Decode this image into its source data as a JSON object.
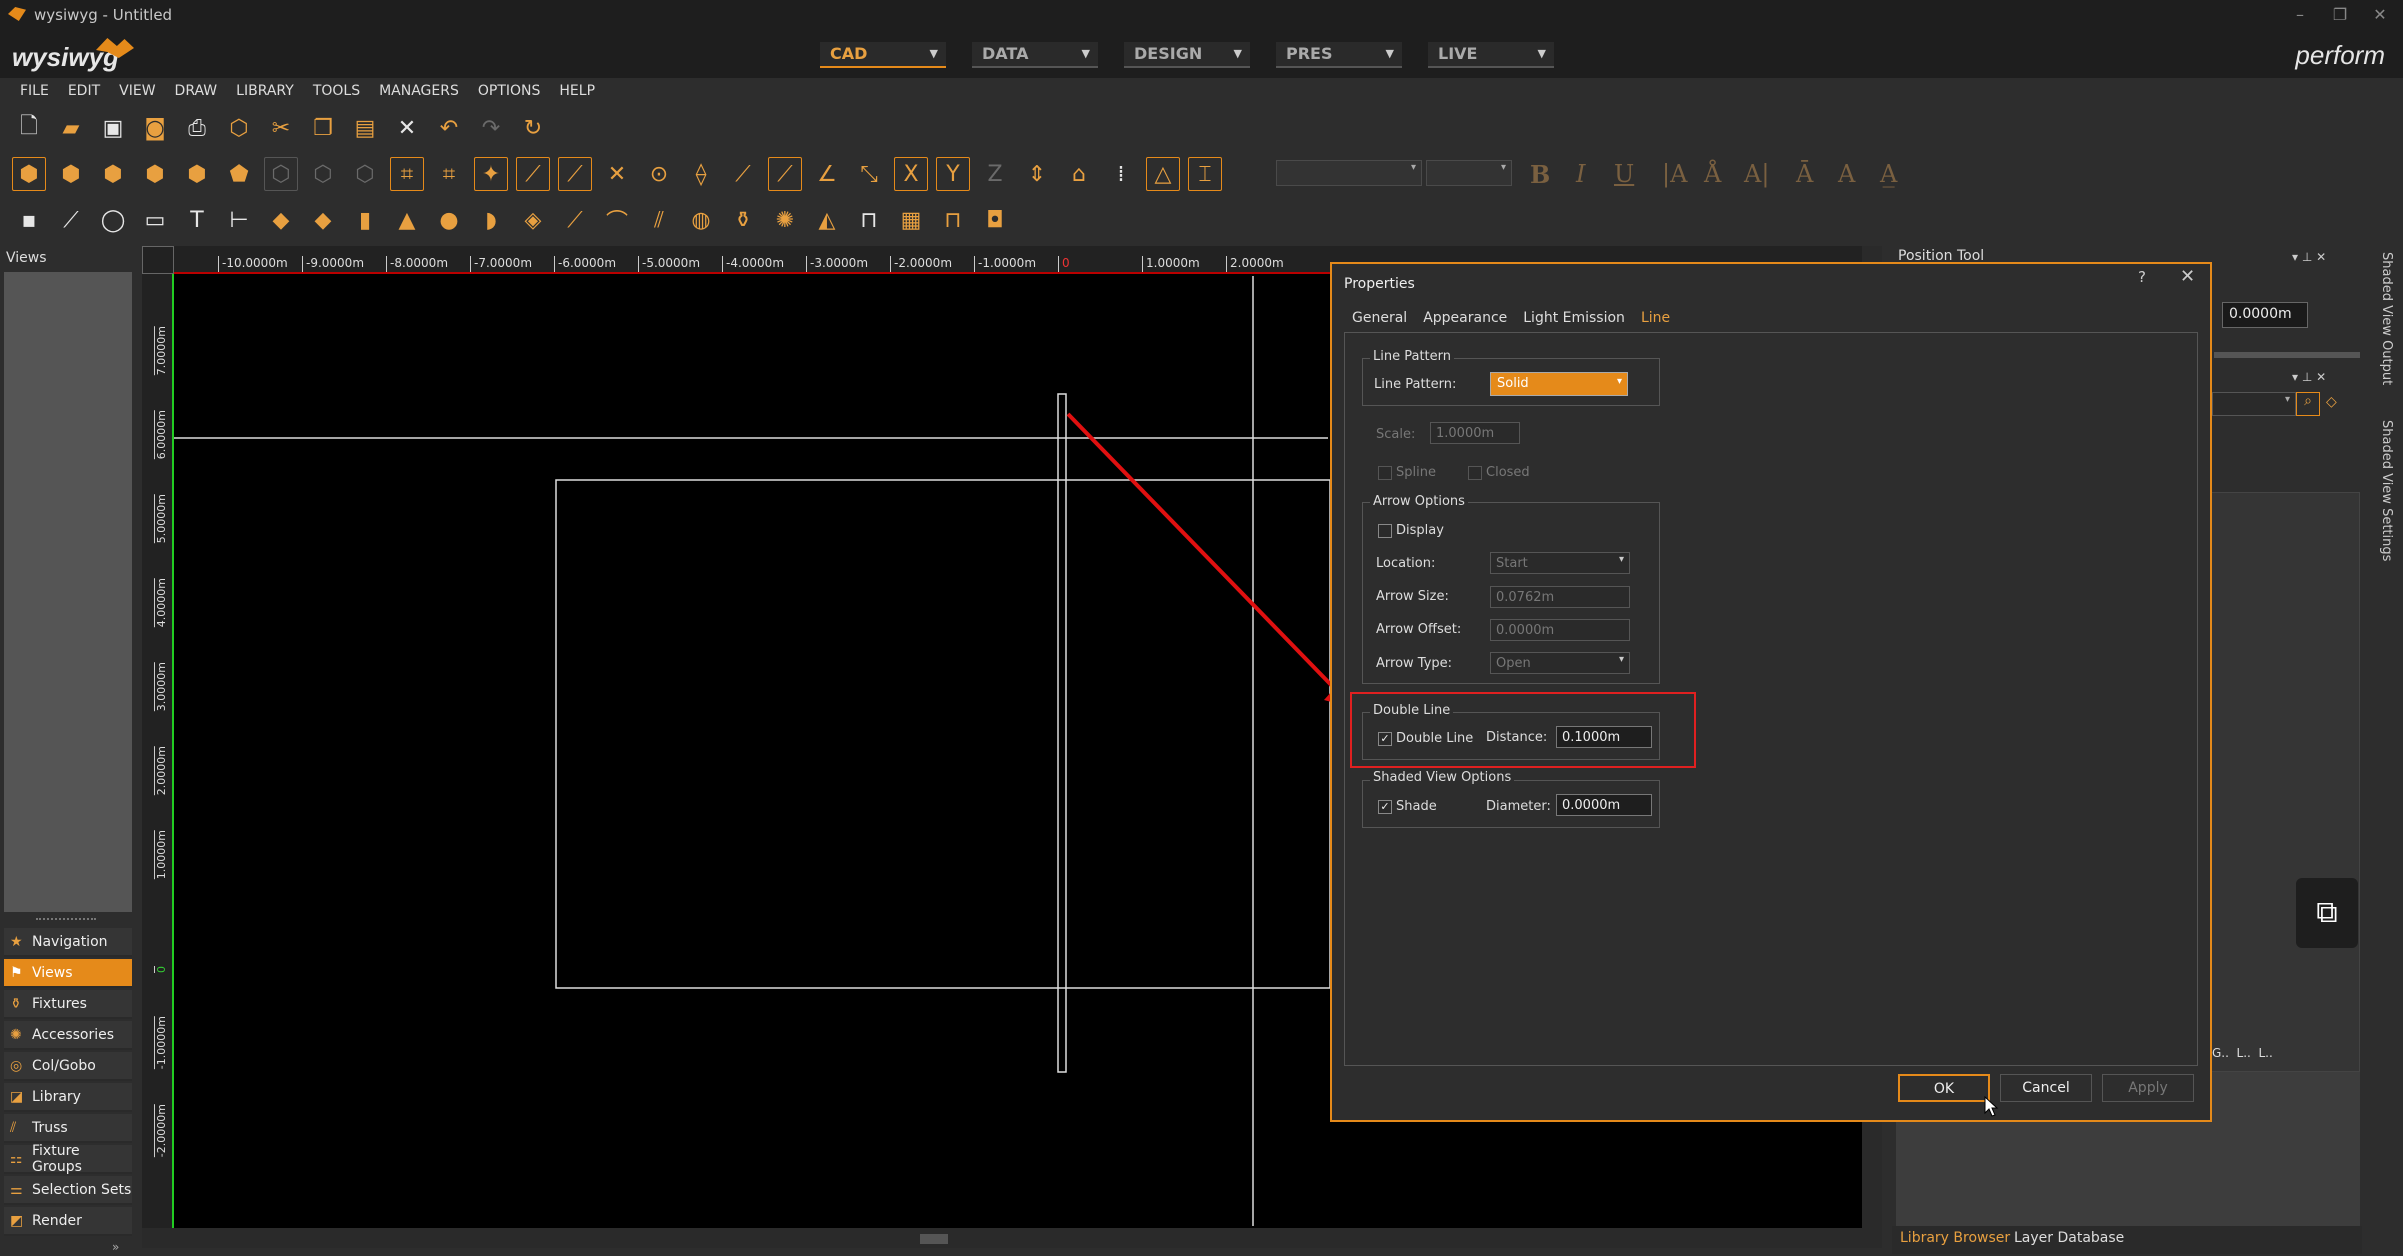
{
  "window": {
    "title": "wysiwyg - Untitled"
  },
  "header": {
    "brand": "wysiwyg",
    "product": "perform",
    "modes": [
      {
        "label": "CAD",
        "active": true
      },
      {
        "label": "DATA",
        "active": false
      },
      {
        "label": "DESIGN",
        "active": false
      },
      {
        "label": "PRES",
        "active": false
      },
      {
        "label": "LIVE",
        "active": false
      }
    ]
  },
  "menu": [
    "FILE",
    "EDIT",
    "VIEW",
    "DRAW",
    "LIBRARY",
    "TOOLS",
    "MANAGERS",
    "OPTIONS",
    "HELP"
  ],
  "toolbar": {
    "axis_x": "X",
    "axis_y": "Y",
    "axis_z": "Z",
    "text_fmt": [
      "B",
      "I",
      "U"
    ]
  },
  "left_panel": {
    "title": "Views",
    "nav": [
      {
        "label": "Navigation",
        "icon": "star-icon",
        "active": false
      },
      {
        "label": "Views",
        "icon": "views-icon",
        "active": true
      },
      {
        "label": "Fixtures",
        "icon": "fixture-icon",
        "active": false
      },
      {
        "label": "Accessories",
        "icon": "gear-icon",
        "active": false
      },
      {
        "label": "Col/Gobo",
        "icon": "gobo-icon",
        "active": false
      },
      {
        "label": "Library",
        "icon": "library-icon",
        "active": false
      },
      {
        "label": "Truss",
        "icon": "truss-icon",
        "active": false
      },
      {
        "label": "Fixture Groups",
        "icon": "groups-icon",
        "active": false
      },
      {
        "label": "Selection Sets",
        "icon": "selection-icon",
        "active": false
      },
      {
        "label": "Render",
        "icon": "render-icon",
        "active": false
      }
    ]
  },
  "viewport": {
    "h_ticks": [
      "-10.0000m",
      "-9.0000m",
      "-8.0000m",
      "-7.0000m",
      "-6.0000m",
      "-5.0000m",
      "-4.0000m",
      "-3.0000m",
      "-2.0000m",
      "-1.0000m",
      "0",
      "1.0000m",
      "2.0000m"
    ],
    "v_ticks": [
      "7.0000m",
      "6.0000m",
      "5.0000m",
      "4.0000m",
      "3.0000m",
      "2.0000m",
      "1.0000m",
      "0",
      "-1.0000m",
      "-2.0000m"
    ]
  },
  "right_panel": {
    "position_tool": "Position Tool",
    "position_value": "0.0000m",
    "tabs": [
      "Library Browser",
      "Layer Database"
    ],
    "side_tabs": [
      "Shaded View Output",
      "Shaded View Settings"
    ]
  },
  "dialog": {
    "title": "Properties",
    "help": "?",
    "close": "✕",
    "tabs": [
      {
        "label": "General",
        "active": false
      },
      {
        "label": "Appearance",
        "active": false
      },
      {
        "label": "Light Emission",
        "active": false
      },
      {
        "label": "Line",
        "active": true
      }
    ],
    "line_pattern": {
      "group": "Line Pattern",
      "label": "Line Pattern:",
      "value": "Solid"
    },
    "scale": {
      "label": "Scale:",
      "value": "1.0000m"
    },
    "spline": {
      "label": "Spline",
      "checked": false
    },
    "closed": {
      "label": "Closed",
      "checked": false
    },
    "arrow": {
      "group": "Arrow Options",
      "display": {
        "label": "Display",
        "checked": false
      },
      "location": {
        "label": "Location:",
        "value": "Start"
      },
      "size": {
        "label": "Arrow Size:",
        "value": "0.0762m"
      },
      "offset": {
        "label": "Arrow Offset:",
        "value": "0.0000m"
      },
      "type": {
        "label": "Arrow Type:",
        "value": "Open"
      }
    },
    "double_line": {
      "group": "Double Line",
      "checkbox": {
        "label": "Double Line",
        "checked": true
      },
      "distance": {
        "label": "Distance:",
        "value": "0.1000m"
      }
    },
    "shaded": {
      "group": "Shaded View Options",
      "shade": {
        "label": "Shade",
        "checked": true
      },
      "diameter": {
        "label": "Diameter:",
        "value": "0.0000m"
      }
    },
    "buttons": {
      "ok": "OK",
      "cancel": "Cancel",
      "apply": "Apply"
    }
  },
  "colors": {
    "accent": "#e58a1a",
    "highlight": "#e02020",
    "arrow": "#e01010"
  }
}
